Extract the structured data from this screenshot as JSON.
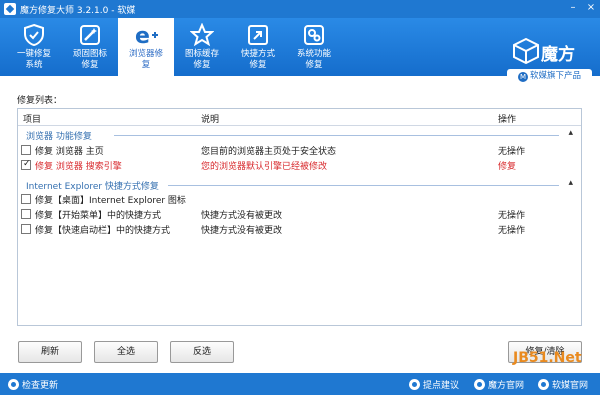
{
  "window": {
    "title": "魔方修复大师 3.2.1.0 - 软媒",
    "min": "–",
    "close": "×"
  },
  "toolbar": {
    "items": [
      {
        "label": "一键修复\n系统",
        "icon": "shield-repair-icon"
      },
      {
        "label": "顽固图标\n修复",
        "icon": "wand-icon"
      },
      {
        "label": "浏览器修\n复",
        "icon": "browser-e-icon",
        "active": true
      },
      {
        "label": "图标缓存\n修复",
        "icon": "star-icon"
      },
      {
        "label": "快捷方式\n修复",
        "icon": "shortcut-arrow-icon"
      },
      {
        "label": "系统功能\n修复",
        "icon": "gears-icon"
      }
    ]
  },
  "brand": {
    "name": "魔方",
    "subtitle": "软媒旗下产品",
    "mark": "M"
  },
  "section_label": "修复列表：",
  "list": {
    "columns": {
      "item": "项目",
      "desc": "说明",
      "op": "操作"
    },
    "groups": [
      {
        "title": "浏览器 功能修复",
        "collapse": "▴",
        "rows": [
          {
            "name": "修复 浏览器 主页",
            "desc": "您目前的浏览器主页处于安全状态",
            "op": "无操作",
            "checked": false,
            "alert": false
          },
          {
            "name": "修复 浏览器 搜索引擎",
            "desc": "您的浏览器默认引擎已经被修改",
            "op": "修复",
            "checked": true,
            "alert": true
          }
        ]
      },
      {
        "title": "Internet Explorer 快捷方式修复",
        "collapse": "▴",
        "rows": [
          {
            "name": "修复【桌面】Internet Explorer 图标",
            "desc": "",
            "op": "",
            "checked": false,
            "alert": false
          },
          {
            "name": "修复【开始菜单】中的快捷方式",
            "desc": "快捷方式没有被更改",
            "op": "无操作",
            "checked": false,
            "alert": false
          },
          {
            "name": "修复【快速启动栏】中的快捷方式",
            "desc": "快捷方式没有被更改",
            "op": "无操作",
            "checked": false,
            "alert": false
          }
        ]
      }
    ]
  },
  "buttons": {
    "refresh": "刷新",
    "select_all": "全选",
    "invert": "反选",
    "repair": "修复/清除"
  },
  "status": {
    "check_update": "检查更新",
    "suggest": "提点建议",
    "official": "魔方官网",
    "ruanmei": "软媒官网"
  },
  "watermark": {
    "text": "JB51.Net"
  },
  "colors": {
    "accent": "#1f78d1",
    "alert": "#d8292d",
    "group": "#3570b0"
  }
}
